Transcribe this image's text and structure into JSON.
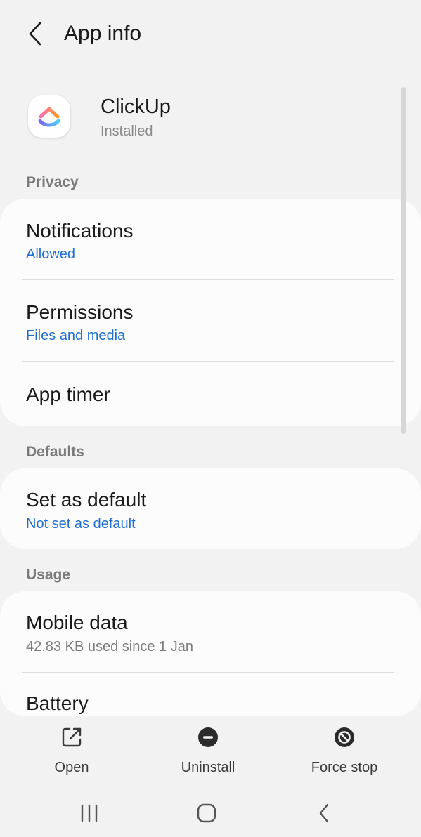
{
  "header": {
    "title": "App info",
    "back_icon": "chevron-left-icon"
  },
  "app": {
    "name": "ClickUp",
    "status": "Installed",
    "icon": "clickup-logo-icon",
    "colors": {
      "pink": "#fd71af",
      "orange": "#ff9b2f",
      "purple": "#7b68ee",
      "blue": "#49ccf9"
    }
  },
  "sections": {
    "privacy": {
      "label": "Privacy",
      "items": [
        {
          "title": "Notifications",
          "subtitle": "Allowed"
        },
        {
          "title": "Permissions",
          "subtitle": "Files and media"
        },
        {
          "title": "App timer"
        }
      ]
    },
    "defaults": {
      "label": "Defaults",
      "items": [
        {
          "title": "Set as default",
          "subtitle": "Not set as default"
        }
      ]
    },
    "usage": {
      "label": "Usage",
      "items": [
        {
          "title": "Mobile data",
          "subtitle": "42.83 KB used since 1 Jan"
        },
        {
          "title": "Battery"
        }
      ]
    }
  },
  "actions": {
    "open": {
      "label": "Open",
      "icon": "open-external-icon"
    },
    "uninstall": {
      "label": "Uninstall",
      "icon": "minus-circle-icon"
    },
    "force_stop": {
      "label": "Force stop",
      "icon": "block-circle-icon"
    }
  },
  "navbar": {
    "recents_icon": "recents-icon",
    "home_icon": "home-icon",
    "back_icon": "back-icon"
  },
  "colors": {
    "background": "#f2f2f2",
    "card": "#fcfcfc",
    "accent_blue": "#1f6fd1",
    "secondary_text": "#7c7c7c"
  }
}
